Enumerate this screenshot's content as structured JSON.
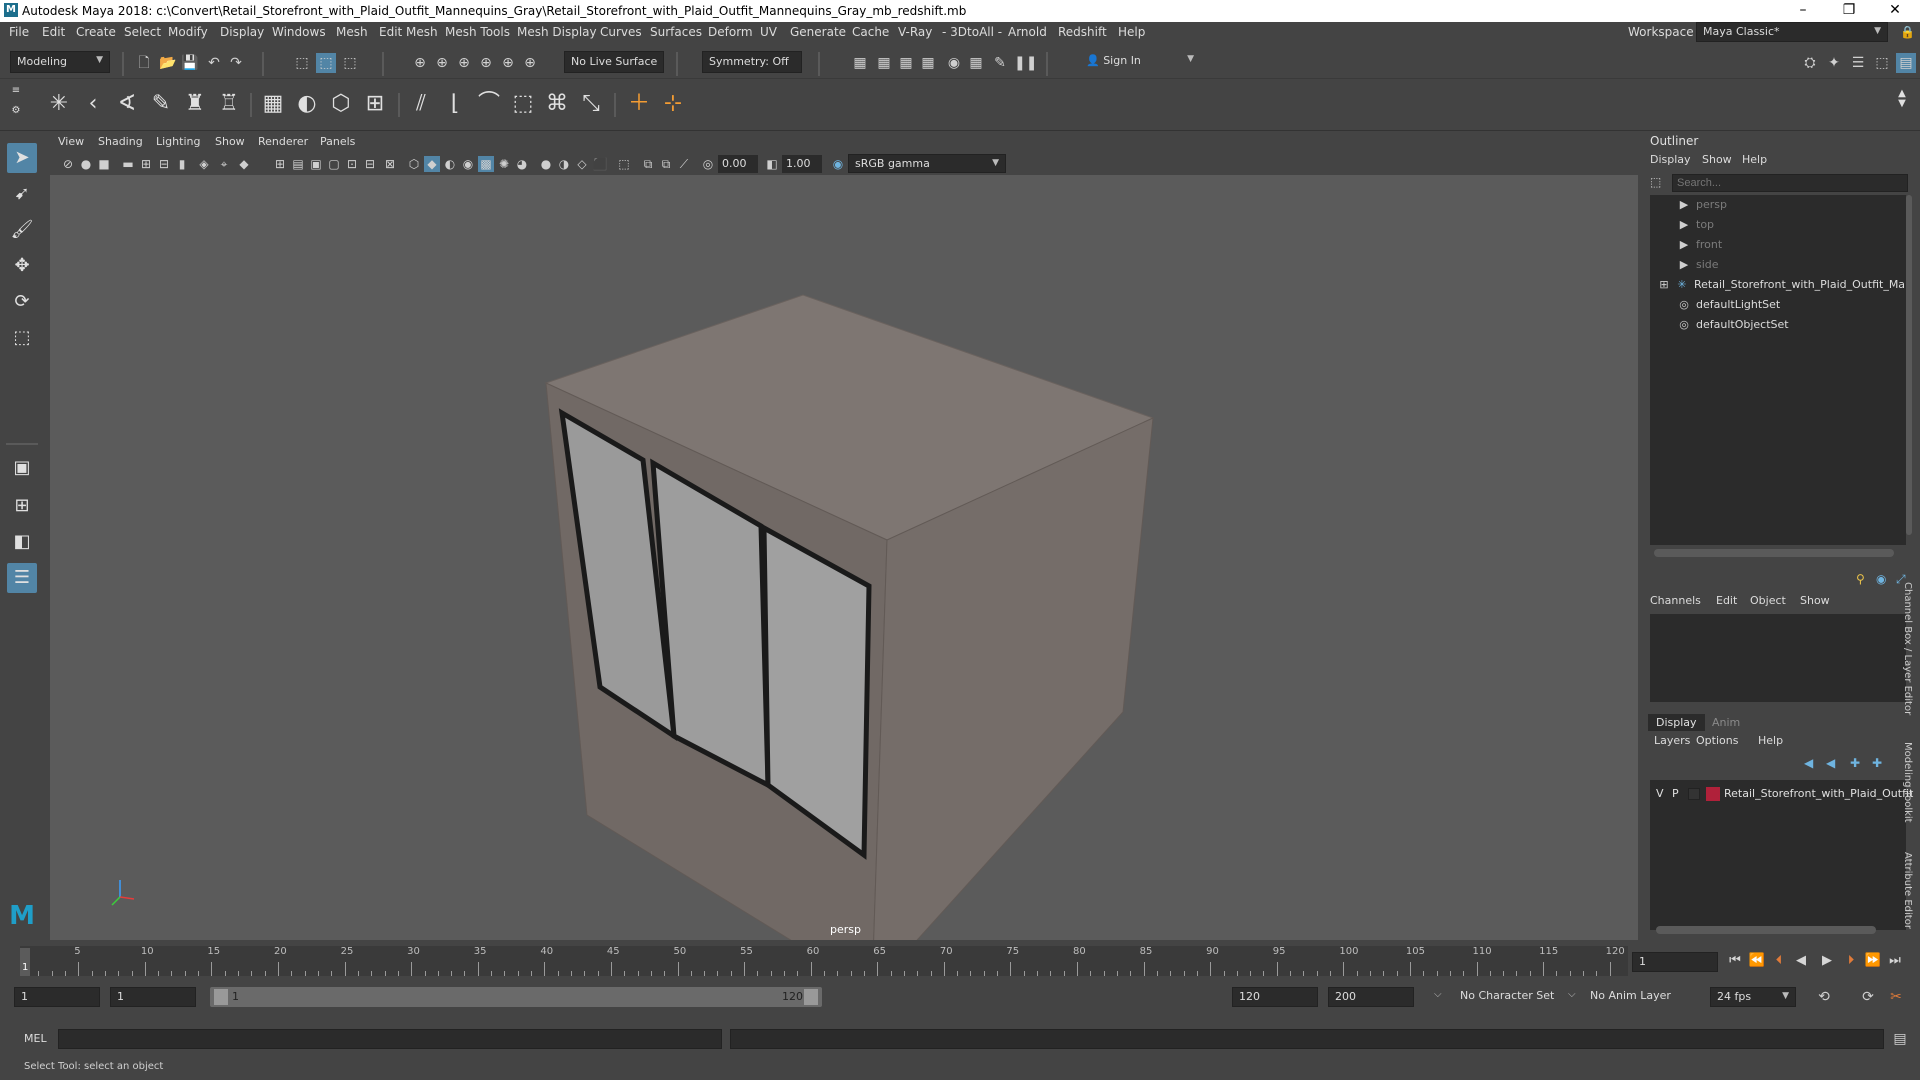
{
  "window": {
    "title": "Autodesk Maya 2018: c:\\Convert\\Retail_Storefront_with_Plaid_Outfit_Mannequins_Gray\\Retail_Storefront_with_Plaid_Outfit_Mannequins_Gray_mb_redshift.mb",
    "logo": "M",
    "minimize": "–",
    "maximize": "❐",
    "close": "✕"
  },
  "menubar": [
    "File",
    "Edit",
    "Create",
    "Select",
    "Modify",
    "Display",
    "Windows",
    "Mesh",
    "Edit Mesh",
    "Mesh Tools",
    "Mesh Display",
    "Curves",
    "Surfaces",
    "Deform",
    "UV",
    "Generate",
    "Cache",
    "V-Ray",
    "- 3DtoAll -",
    "Arnold",
    "Redshift",
    "Help"
  ],
  "workspace": {
    "label": "Workspace :",
    "value": "Maya Classic*"
  },
  "statusline": {
    "mode": "Modeling",
    "live_surface": "No Live Surface",
    "symmetry": "Symmetry: Off",
    "sign_in": "Sign In"
  },
  "viewport": {
    "menus": [
      "View",
      "Shading",
      "Lighting",
      "Show",
      "Renderer",
      "Panels"
    ],
    "exposure": "0.00",
    "gamma": "1.00",
    "color_space": "sRGB gamma",
    "camera_label": "persp"
  },
  "outliner": {
    "title": "Outliner",
    "menus": [
      "Display",
      "Show",
      "Help"
    ],
    "search_placeholder": "Search...",
    "items": [
      {
        "label": "persp",
        "icon": "camera-icon",
        "dim": true
      },
      {
        "label": "top",
        "icon": "camera-icon",
        "dim": true
      },
      {
        "label": "front",
        "icon": "camera-icon",
        "dim": true
      },
      {
        "label": "side",
        "icon": "camera-icon",
        "dim": true
      },
      {
        "label": "Retail_Storefront_with_Plaid_Outfit_Man",
        "icon": "transform-icon",
        "dim": false,
        "expandable": true
      },
      {
        "label": "defaultLightSet",
        "icon": "set-icon",
        "dim": false
      },
      {
        "label": "defaultObjectSet",
        "icon": "set-icon",
        "dim": false
      }
    ]
  },
  "channelbox": {
    "menus": [
      "Channels",
      "Edit",
      "Object",
      "Show"
    ]
  },
  "layereditor": {
    "tabs": [
      "Display",
      "Anim"
    ],
    "menus": [
      "Layers",
      "Options",
      "Help"
    ],
    "layer": {
      "v": "V",
      "p": "P",
      "name": "Retail_Storefront_with_Plaid_Outfit",
      "color": "#b0213a"
    }
  },
  "side_tabs": [
    "Channel Box / Layer Editor",
    "Modeling Toolkit",
    "Attribute Editor"
  ],
  "timeline": {
    "ticks": [
      5,
      10,
      15,
      20,
      25,
      30,
      35,
      40,
      45,
      50,
      55,
      60,
      65,
      70,
      75,
      80,
      85,
      90,
      95,
      100,
      105,
      110,
      115,
      120
    ],
    "current_frame": "1",
    "frame_field": "1"
  },
  "range": {
    "start": "1",
    "playback_start": "1",
    "slider_start": "1",
    "slider_end": "120",
    "playback_end": "120",
    "end": "200",
    "character_set": "No Character Set",
    "anim_layer": "No Anim Layer",
    "fps": "24 fps"
  },
  "cmdline": {
    "label": "MEL"
  },
  "helpline": {
    "text": "Select Tool: select an object"
  },
  "colors": {
    "bg": "#444444",
    "viewport": "#5b5b5b",
    "accent": "#5285a6",
    "mesh_top": "#7e7672",
    "mesh_side": "#756d69",
    "glass": "#9a9a9a"
  }
}
